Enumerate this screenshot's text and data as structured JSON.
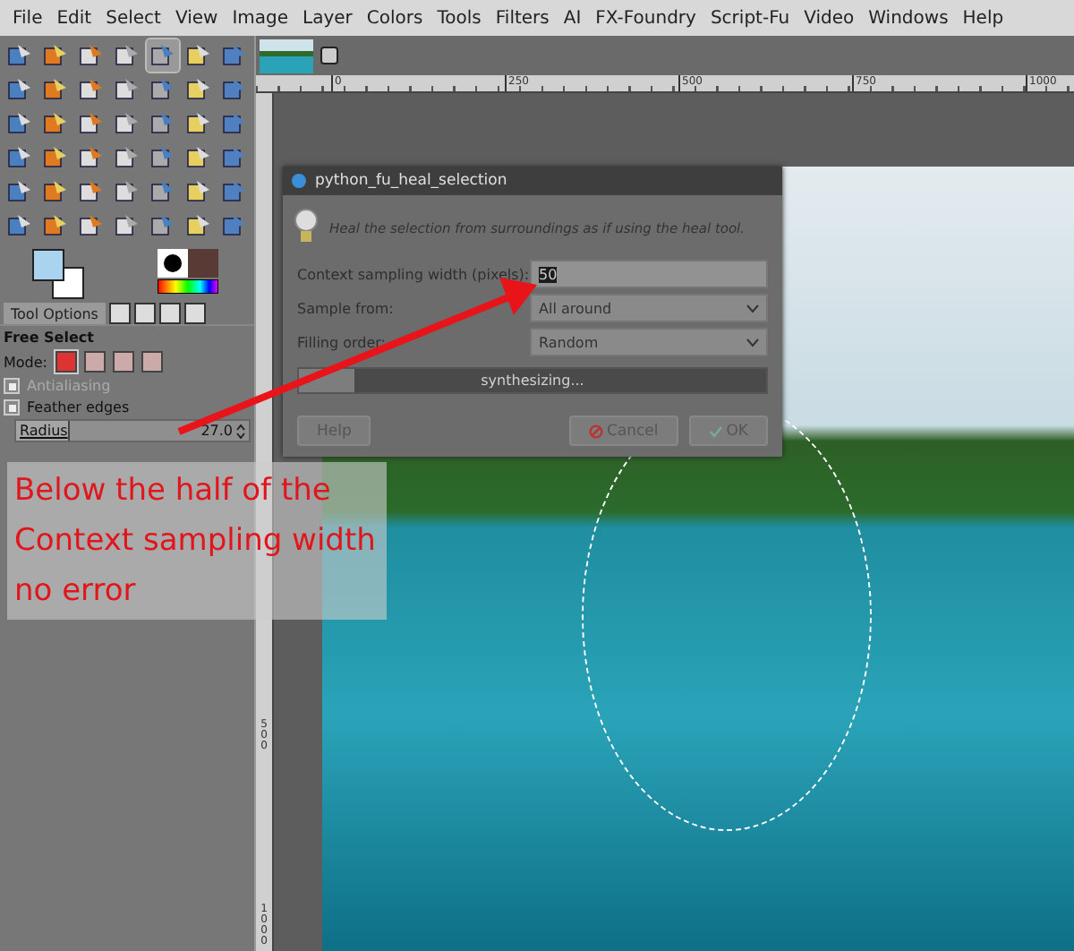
{
  "menu": [
    "File",
    "Edit",
    "Select",
    "View",
    "Image",
    "Layer",
    "Colors",
    "Tools",
    "Filters",
    "AI",
    "FX-Foundry",
    "Script-Fu",
    "Video",
    "Windows",
    "Help"
  ],
  "tools": [
    {
      "selected": false
    },
    {
      "selected": false
    },
    {
      "selected": false
    },
    {
      "selected": false
    },
    {
      "selected": true
    },
    {
      "selected": false
    },
    {
      "selected": false
    },
    {
      "selected": false
    },
    {
      "selected": false
    },
    {
      "selected": false
    },
    {
      "selected": false
    },
    {
      "selected": false
    },
    {
      "selected": false
    },
    {
      "selected": false
    },
    {
      "selected": false
    },
    {
      "selected": false
    },
    {
      "selected": false
    },
    {
      "selected": false
    },
    {
      "selected": false
    },
    {
      "selected": false
    },
    {
      "selected": false
    },
    {
      "selected": false
    },
    {
      "selected": false
    },
    {
      "selected": false
    },
    {
      "selected": false
    },
    {
      "selected": false
    },
    {
      "selected": false
    },
    {
      "selected": false
    },
    {
      "selected": false
    },
    {
      "selected": false
    },
    {
      "selected": false
    },
    {
      "selected": false
    },
    {
      "selected": false
    },
    {
      "selected": false
    },
    {
      "selected": false
    },
    {
      "selected": false
    },
    {
      "selected": false
    },
    {
      "selected": false
    },
    {
      "selected": false
    },
    {
      "selected": false
    },
    {
      "selected": false
    },
    {
      "selected": false
    }
  ],
  "tool_options": {
    "tab": {
      "label": "Tool Options",
      "selected": true
    },
    "title": "Free Select",
    "mode_label": "Mode:",
    "modes": [
      {
        "selected": true
      },
      {
        "selected": false
      },
      {
        "selected": false
      },
      {
        "selected": false
      }
    ],
    "options": [
      {
        "label": "Antialiasing",
        "checked": true,
        "disabled": true
      },
      {
        "label": "Feather edges",
        "checked": true,
        "disabled": false
      }
    ],
    "radius": {
      "label": "Radius",
      "value": "27.0",
      "level": 0.22
    }
  },
  "ruler": {
    "horizontal": [
      "0",
      "250",
      "500",
      "750",
      "1000"
    ],
    "vertical": [
      "500",
      "1000"
    ]
  },
  "dialog": {
    "title": "python_fu_heal_selection",
    "description": "Heal the selection from surroundings as if using the heal tool.",
    "fields": [
      {
        "kind": "entry",
        "label": "Context sampling width (pixels):",
        "value": "50"
      },
      {
        "kind": "select",
        "label": "Sample from:",
        "value": "All around"
      },
      {
        "kind": "select",
        "label": "Filling order:",
        "value": "Random"
      }
    ],
    "progress": {
      "text": "synthesizing...",
      "level": 0.12
    },
    "buttons": [
      {
        "kind": "help",
        "label": "Help"
      },
      {
        "kind": "cancel",
        "label": "Cancel"
      },
      {
        "kind": "ok",
        "label": "OK"
      }
    ]
  },
  "note": [
    "Below the half of the",
    "Context sampling width",
    "no error"
  ]
}
